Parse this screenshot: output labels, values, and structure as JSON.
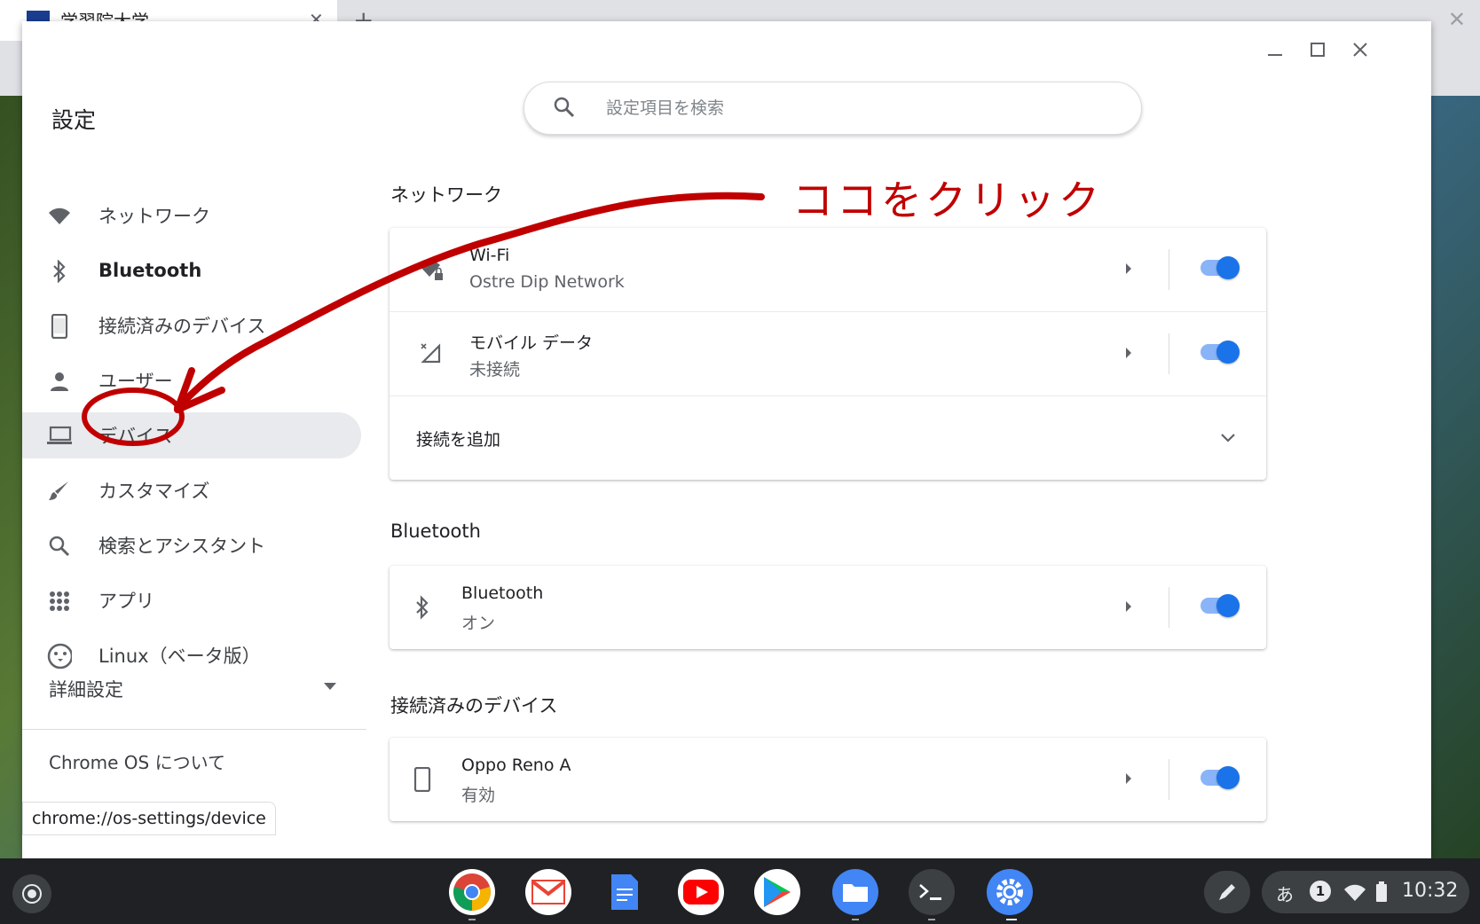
{
  "browser": {
    "tab_title": "学習院大学",
    "tab_close": "✕",
    "new_tab": "+",
    "close": "✕"
  },
  "window": {
    "app_title": "設定"
  },
  "search": {
    "placeholder": "設定項目を検索"
  },
  "sidebar": {
    "items": [
      {
        "label": "ネットワーク",
        "icon": "wifi-icon"
      },
      {
        "label": "Bluetooth",
        "icon": "bluetooth-icon"
      },
      {
        "label": "接続済みのデバイス",
        "icon": "phone-icon"
      },
      {
        "label": "ユーザー",
        "icon": "person-icon"
      },
      {
        "label": "デバイス",
        "icon": "laptop-icon"
      },
      {
        "label": "カスタマイズ",
        "icon": "brush-icon"
      },
      {
        "label": "検索とアシスタント",
        "icon": "search-icon"
      },
      {
        "label": "アプリ",
        "icon": "apps-grid-icon"
      },
      {
        "label": "Linux（ベータ版）",
        "icon": "penguin-icon"
      }
    ],
    "advanced": "詳細設定",
    "about": "Chrome OS について"
  },
  "status_url": "chrome://os-settings/device",
  "sections": {
    "network": {
      "title": "ネットワーク",
      "wifi": {
        "name": "Wi-Fi",
        "status": "Ostre Dip Network"
      },
      "mobile": {
        "name": "モバイル データ",
        "status": "未接続"
      },
      "add": "接続を追加"
    },
    "bluetooth": {
      "title": "Bluetooth",
      "row": {
        "name": "Bluetooth",
        "status": "オン"
      }
    },
    "connected": {
      "title": "接続済みのデバイス",
      "row": {
        "name": "Oppo Reno A",
        "status": "有効"
      }
    }
  },
  "annotation": {
    "text": "ココをクリック",
    "color": "#c00000"
  },
  "shelf": {
    "ime": "あ",
    "notification_count": "1",
    "time": "10:32"
  },
  "colors": {
    "accent": "#1a73e8",
    "toggle_track": "#8ab4f8"
  }
}
